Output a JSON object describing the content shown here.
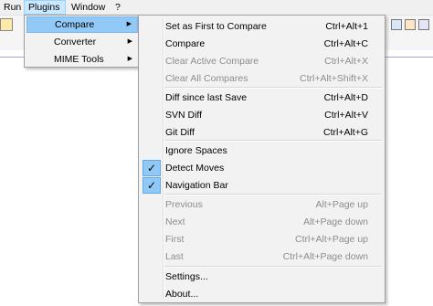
{
  "menubar": {
    "items": [
      "Run",
      "Plugins",
      "Window",
      "?"
    ]
  },
  "plugins_menu": {
    "items": [
      {
        "label": "Compare",
        "has_submenu": true,
        "hot": true
      },
      {
        "label": "Converter",
        "has_submenu": true,
        "hot": false
      },
      {
        "label": "MIME Tools",
        "has_submenu": true,
        "hot": false
      }
    ],
    "arrow": "▶"
  },
  "compare_menu": {
    "items": [
      {
        "label": "Set as First to Compare",
        "shortcut": "Ctrl+Alt+1",
        "enabled": true,
        "checked": false
      },
      {
        "label": "Compare",
        "shortcut": "Ctrl+Alt+C",
        "enabled": true,
        "checked": false
      },
      {
        "label": "Clear Active Compare",
        "shortcut": "Ctrl+Alt+X",
        "enabled": false,
        "checked": false
      },
      {
        "label": "Clear All Compares",
        "shortcut": "Ctrl+Alt+Shift+X",
        "enabled": false,
        "checked": false
      },
      {
        "label": "Diff since last Save",
        "shortcut": "Ctrl+Alt+D",
        "enabled": true,
        "checked": false
      },
      {
        "label": "SVN Diff",
        "shortcut": "Ctrl+Alt+V",
        "enabled": true,
        "checked": false
      },
      {
        "label": "Git Diff",
        "shortcut": "Ctrl+Alt+G",
        "enabled": true,
        "checked": false
      },
      {
        "label": "Ignore Spaces",
        "shortcut": "",
        "enabled": true,
        "checked": false
      },
      {
        "label": "Detect Moves",
        "shortcut": "",
        "enabled": true,
        "checked": true
      },
      {
        "label": "Navigation Bar",
        "shortcut": "",
        "enabled": true,
        "checked": true
      },
      {
        "label": "Previous",
        "shortcut": "Alt+Page up",
        "enabled": false,
        "checked": false
      },
      {
        "label": "Next",
        "shortcut": "Alt+Page down",
        "enabled": false,
        "checked": false
      },
      {
        "label": "First",
        "shortcut": "Ctrl+Alt+Page up",
        "enabled": false,
        "checked": false
      },
      {
        "label": "Last",
        "shortcut": "Ctrl+Alt+Page down",
        "enabled": false,
        "checked": false
      },
      {
        "label": "Settings...",
        "shortcut": "",
        "enabled": true,
        "checked": false
      },
      {
        "label": "About...",
        "shortcut": "",
        "enabled": true,
        "checked": false
      }
    ],
    "check_glyph": "✓"
  },
  "colors": {
    "menu_bg": "#f2f2f2",
    "highlight": "#91c9f7",
    "disabled_text": "#8d8d8d",
    "menubar_active": "#cce8ff"
  }
}
